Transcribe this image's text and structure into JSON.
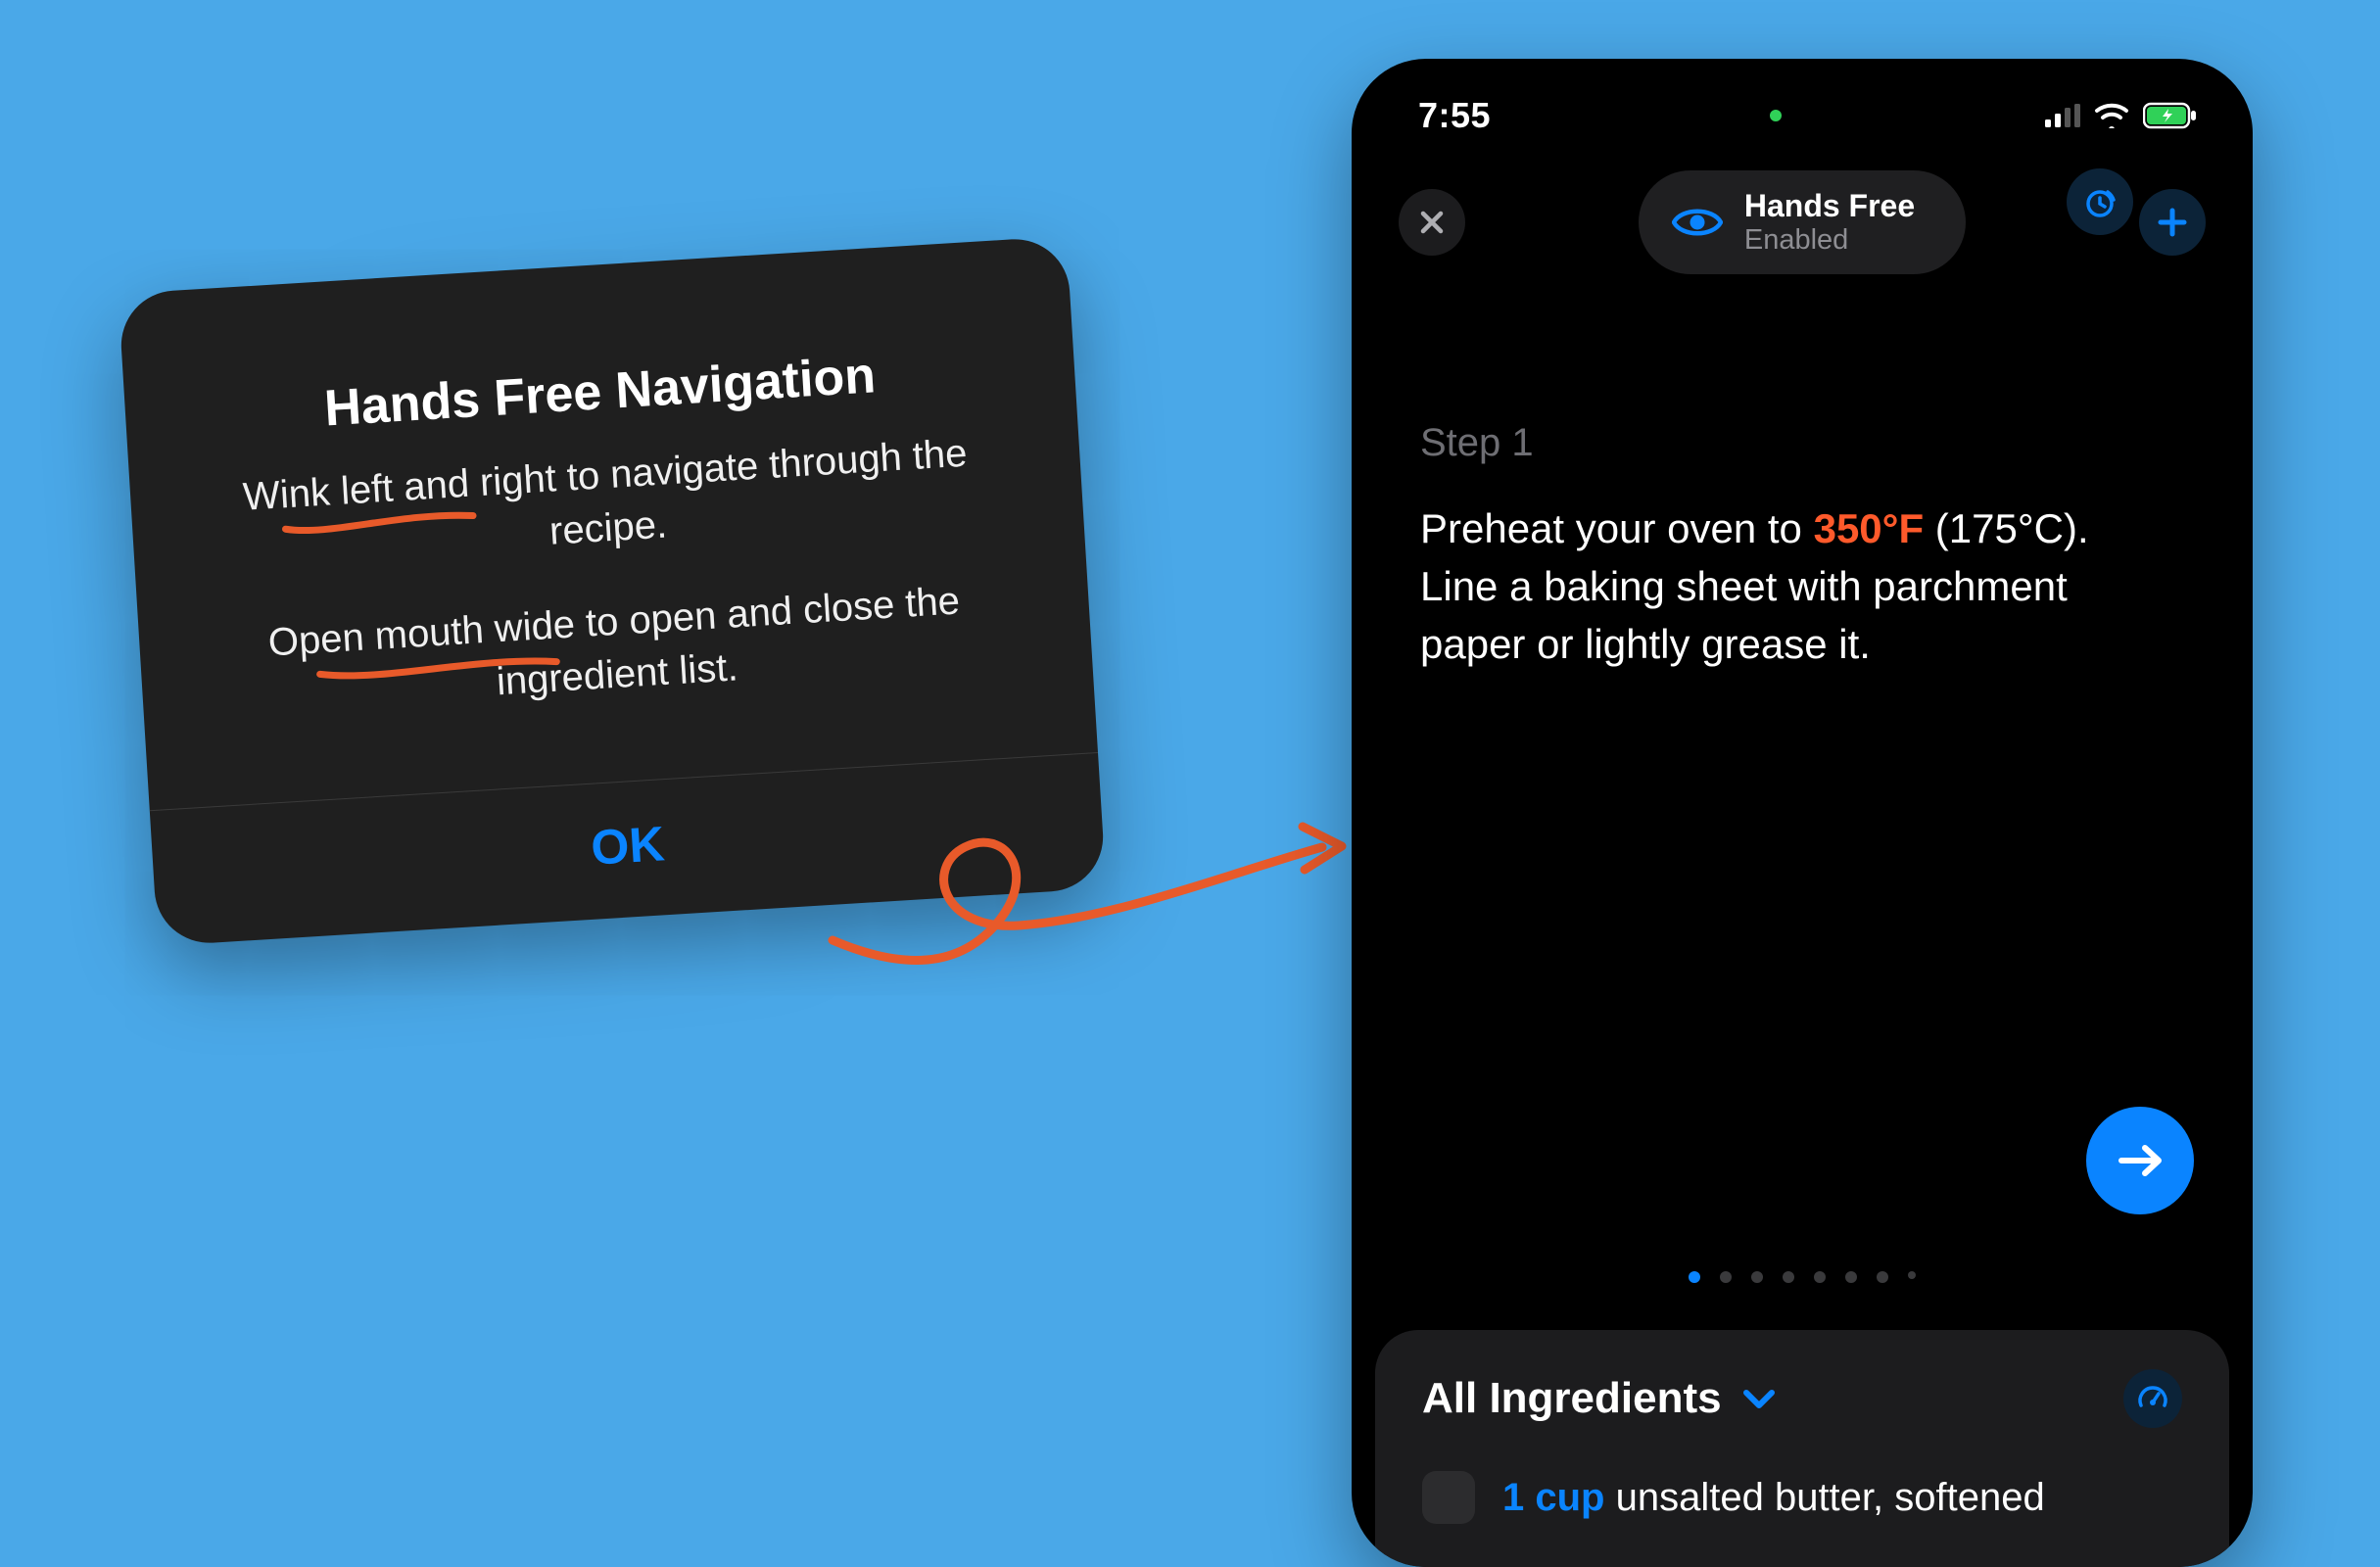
{
  "dialog": {
    "title": "Hands Free Navigation",
    "line1_pre": "Wink left",
    "line1_rest": " and right to navigate through the recipe.",
    "line2_pre": "Open mouth",
    "line2_rest": " wide to open and close the ingredient list.",
    "ok_label": "OK"
  },
  "phone": {
    "status": {
      "time": "7:55"
    },
    "pill": {
      "title": "Hands Free",
      "subtitle": "Enabled"
    },
    "step": {
      "label": "Step 1",
      "pre": "Preheat your oven to ",
      "temp": "350°F",
      "post": " (175°C). Line a baking sheet with parchment paper or lightly grease it."
    },
    "ingredients": {
      "header": "All Ingredients",
      "items": [
        {
          "qty": "1 cup",
          "name": "unsalted butter, softened"
        }
      ]
    },
    "pagination": {
      "total": 8,
      "active_index": 0
    }
  },
  "colors": {
    "accent_blue": "#0a84ff",
    "accent_orange": "#ff5a2b",
    "background": "#4aa8e8"
  }
}
